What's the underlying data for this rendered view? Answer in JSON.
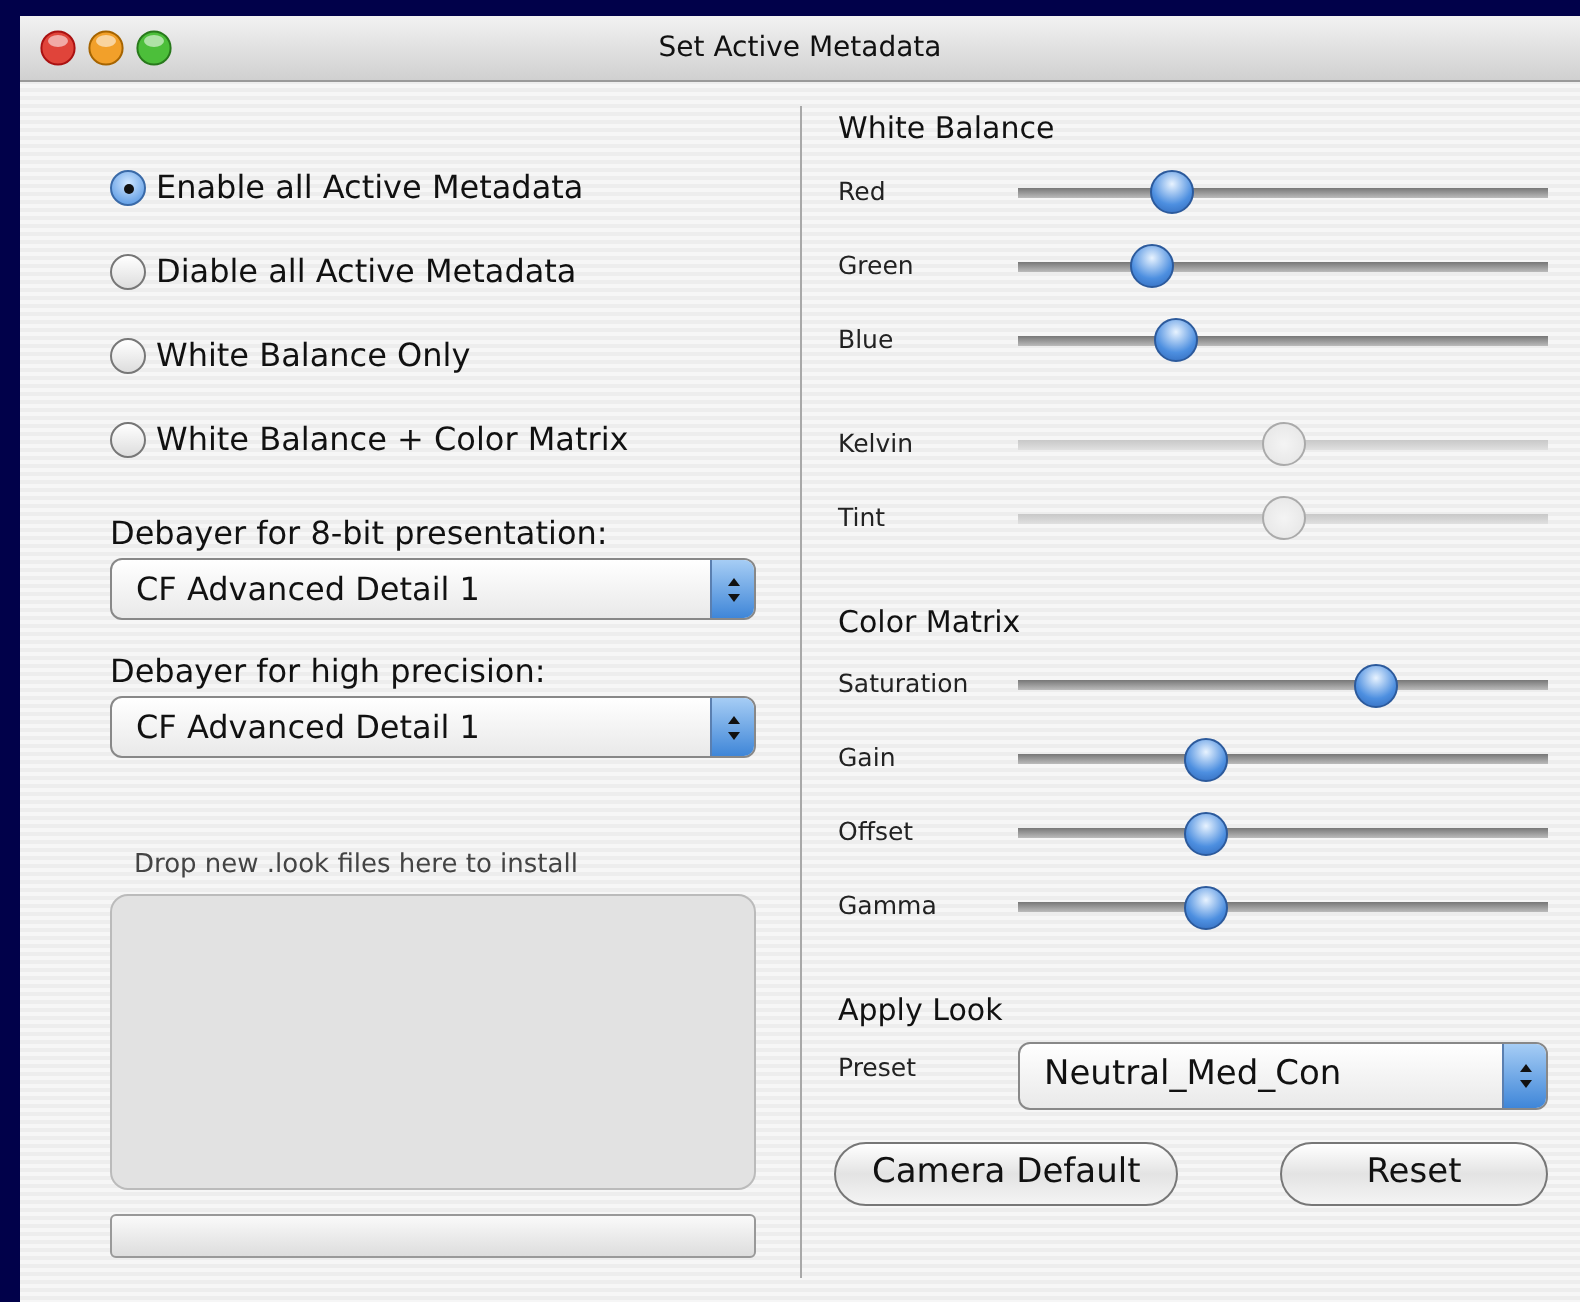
{
  "window": {
    "title": "Set Active Metadata"
  },
  "radio_options": [
    {
      "label": "Enable all Active Metadata",
      "selected": true
    },
    {
      "label": "Diable all Active Metadata",
      "selected": false
    },
    {
      "label": "White Balance Only",
      "selected": false
    },
    {
      "label": "White Balance + Color Matrix",
      "selected": false
    }
  ],
  "debayer": [
    {
      "label": "Debayer for 8-bit presentation:",
      "value": "CF Advanced Detail 1"
    },
    {
      "label": "Debayer for high precision:",
      "value": "CF Advanced Detail 1"
    }
  ],
  "drop_zone": {
    "label": "Drop new .look files here to install"
  },
  "progress": {
    "level": 0
  },
  "white_balance": {
    "title": "White Balance",
    "slider_groups": [
      [
        {
          "label": "Red",
          "level": 0.27,
          "disabled": false
        },
        {
          "label": "Green",
          "level": 0.23,
          "disabled": false
        },
        {
          "label": "Blue",
          "level": 0.28,
          "disabled": false
        }
      ],
      [
        {
          "label": "Kelvin",
          "level": 0.5,
          "disabled": true
        },
        {
          "label": "Tint",
          "level": 0.5,
          "disabled": true
        }
      ]
    ]
  },
  "color_matrix": {
    "title": "Color Matrix",
    "slider_groups": [
      [
        {
          "label": "Saturation",
          "level": 0.69,
          "disabled": false
        },
        {
          "label": "Gain",
          "level": 0.34,
          "disabled": false
        },
        {
          "label": "Offset",
          "level": 0.34,
          "disabled": false
        },
        {
          "label": "Gamma",
          "level": 0.34,
          "disabled": false
        }
      ]
    ]
  },
  "apply_look": {
    "title": "Apply Look",
    "preset": {
      "label": "Preset",
      "value": "Neutral_Med_Con"
    }
  },
  "buttons": [
    "Camera Default",
    "Reset"
  ]
}
